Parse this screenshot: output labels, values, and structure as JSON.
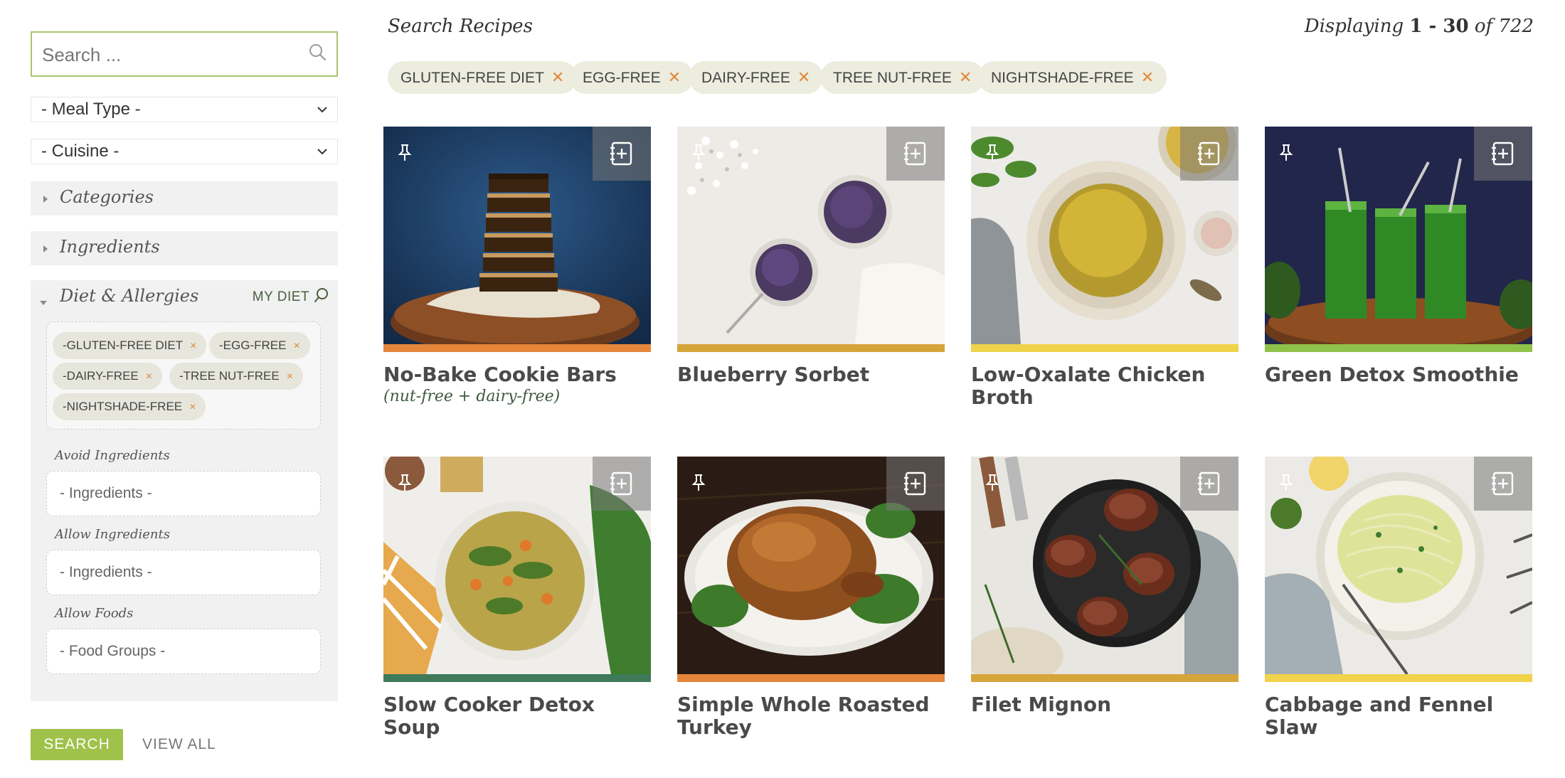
{
  "sidebar": {
    "search_placeholder": "Search ...",
    "meal_type": "- Meal Type -",
    "cuisine": "- Cuisine -",
    "accordions": [
      "Categories",
      "Ingredients",
      "Diet & Allergies"
    ],
    "my_diet": "MY DIET",
    "diet_chips": [
      "-GLUTEN-FREE DIET",
      "-EGG-FREE",
      "-DAIRY-FREE",
      "-TREE NUT-FREE",
      "-NIGHTSHADE-FREE"
    ],
    "chip_remove": "×",
    "avoid_label": "Avoid Ingredients",
    "avoid_placeholder": "- Ingredients -",
    "allow_label": "Allow Ingredients",
    "allow_placeholder": "- Ingredients -",
    "foods_label": "Allow Foods",
    "foods_placeholder": "- Food Groups -",
    "search_button": "SEARCH",
    "view_all_button": "VIEW ALL"
  },
  "header": {
    "title": "Search Recipes",
    "results_prefix": "Displaying",
    "results_range": "1 - 30",
    "results_of": "of 722"
  },
  "filters": [
    "GLUTEN-FREE DIET",
    "EGG-FREE",
    "DAIRY-FREE",
    "TREE NUT-FREE",
    "NIGHTSHADE-FREE"
  ],
  "filter_remove": "✕",
  "recipes": [
    {
      "title": "No-Bake Cookie Bars",
      "subtitle": "(nut-free + dairy-free)",
      "bar_color": "#e5863a"
    },
    {
      "title": "Blueberry Sorbet",
      "subtitle": "",
      "bar_color": "#d6a53a"
    },
    {
      "title": "Low-Oxalate Chicken Broth",
      "subtitle": "",
      "bar_color": "#f0d34a"
    },
    {
      "title": "Green Detox Smoothie",
      "subtitle": "",
      "bar_color": "#8fc24a"
    },
    {
      "title": "Slow Cooker Detox Soup",
      "subtitle": "",
      "bar_color": "#3f7a5a"
    },
    {
      "title": "Simple Whole Roasted Turkey",
      "subtitle": "",
      "bar_color": "#e5863a"
    },
    {
      "title": "Filet Mignon",
      "subtitle": "",
      "bar_color": "#d6a53a"
    },
    {
      "title": "Cabbage and Fennel Slaw",
      "subtitle": "",
      "bar_color": "#f0d34a"
    }
  ]
}
